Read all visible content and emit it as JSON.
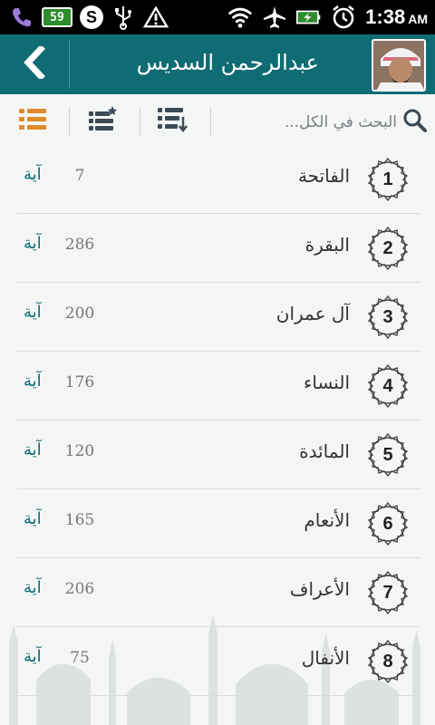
{
  "status_bar": {
    "battery_level": "59",
    "s_label": "S",
    "time": "1:38",
    "ampm": "AM"
  },
  "header": {
    "title": "عبدالرحمن السديس",
    "back_icon": "chevron-left-icon",
    "avatar_icon": "reciter-avatar"
  },
  "toolbar": {
    "search_placeholder": "البحث في الكل...",
    "icons": [
      "list-icon",
      "favorites-list-icon",
      "download-list-icon",
      "search-icon"
    ],
    "accent_color": "#e08a2c"
  },
  "colors": {
    "header_bg": "#0f6b74",
    "ayah_label": "#0f6b74"
  },
  "surahs": [
    {
      "number": "1",
      "name": "الفاتحة",
      "ayahs": "7",
      "unit": "آية"
    },
    {
      "number": "2",
      "name": "البقرة",
      "ayahs": "286",
      "unit": "آية"
    },
    {
      "number": "3",
      "name": "آل عمران",
      "ayahs": "200",
      "unit": "آية"
    },
    {
      "number": "4",
      "name": "النساء",
      "ayahs": "176",
      "unit": "آية"
    },
    {
      "number": "5",
      "name": "المائدة",
      "ayahs": "120",
      "unit": "آية"
    },
    {
      "number": "6",
      "name": "الأنعام",
      "ayahs": "165",
      "unit": "آية"
    },
    {
      "number": "7",
      "name": "الأعراف",
      "ayahs": "206",
      "unit": "آية"
    },
    {
      "number": "8",
      "name": "الأنفال",
      "ayahs": "75",
      "unit": "آية"
    }
  ]
}
